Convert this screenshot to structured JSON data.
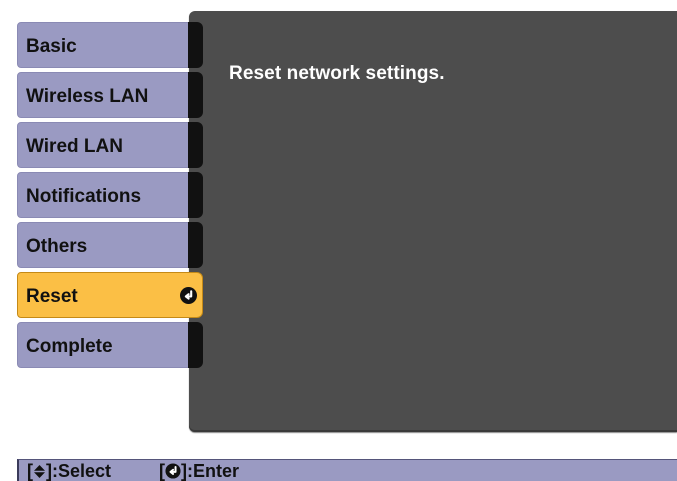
{
  "menu": {
    "items": [
      {
        "label": "Basic"
      },
      {
        "label": "Wireless LAN"
      },
      {
        "label": "Wired LAN"
      },
      {
        "label": "Notifications"
      },
      {
        "label": "Others"
      },
      {
        "label": "Reset",
        "selected": true,
        "icon": "enter-icon"
      },
      {
        "label": "Complete"
      }
    ]
  },
  "panel": {
    "message": "Reset network settings."
  },
  "help": {
    "select_prefix": "[",
    "select_icon": "up-down-arrow-icon",
    "select_suffix": "]:Select",
    "enter_prefix": "[",
    "enter_icon": "enter-icon",
    "enter_suffix": "]:Enter"
  },
  "colors": {
    "panel_bg": "#4d4d4d",
    "tab_bg": "#9a9ac2",
    "selected_bg": "#fbbf45",
    "tab_edge": "#111111"
  }
}
